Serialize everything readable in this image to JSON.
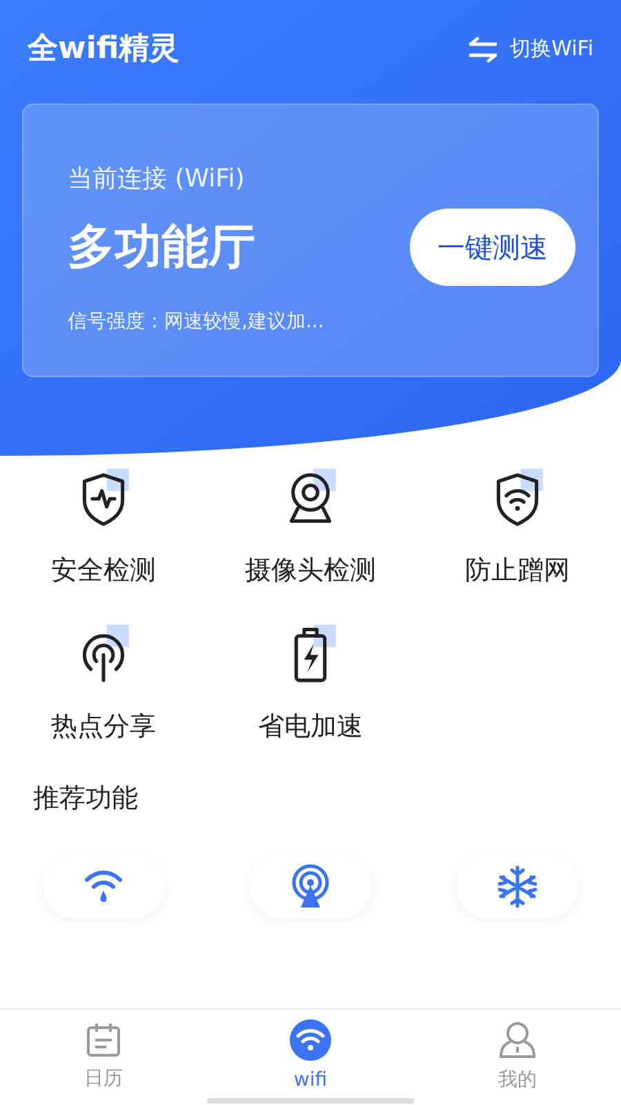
{
  "header": {
    "title": "全wifi精灵",
    "switch_label": "切换WiFi"
  },
  "card": {
    "caption": "当前连接 (WiFi)",
    "network": "多功能厅",
    "speed_button": "一键测速",
    "signal": "信号强度：网速较慢,建议加..."
  },
  "features": [
    {
      "kind": "shield-pulse",
      "label": "安全检测"
    },
    {
      "kind": "camera",
      "label": "摄像头检测"
    },
    {
      "kind": "shield-wifi",
      "label": "防止蹭网"
    },
    {
      "kind": "hotspot",
      "label": "热点分享"
    },
    {
      "kind": "battery",
      "label": "省电加速"
    }
  ],
  "recommended": {
    "title": "推荐功能",
    "items": [
      {
        "kind": "wifi-drop"
      },
      {
        "kind": "antenna"
      },
      {
        "kind": "snowflake"
      }
    ]
  },
  "tab_bar": [
    {
      "kind": "calendar",
      "label": "日历",
      "selected": false
    },
    {
      "kind": "wifi",
      "label": "wifi",
      "selected": true
    },
    {
      "kind": "person",
      "label": "我的",
      "selected": false
    }
  ]
}
